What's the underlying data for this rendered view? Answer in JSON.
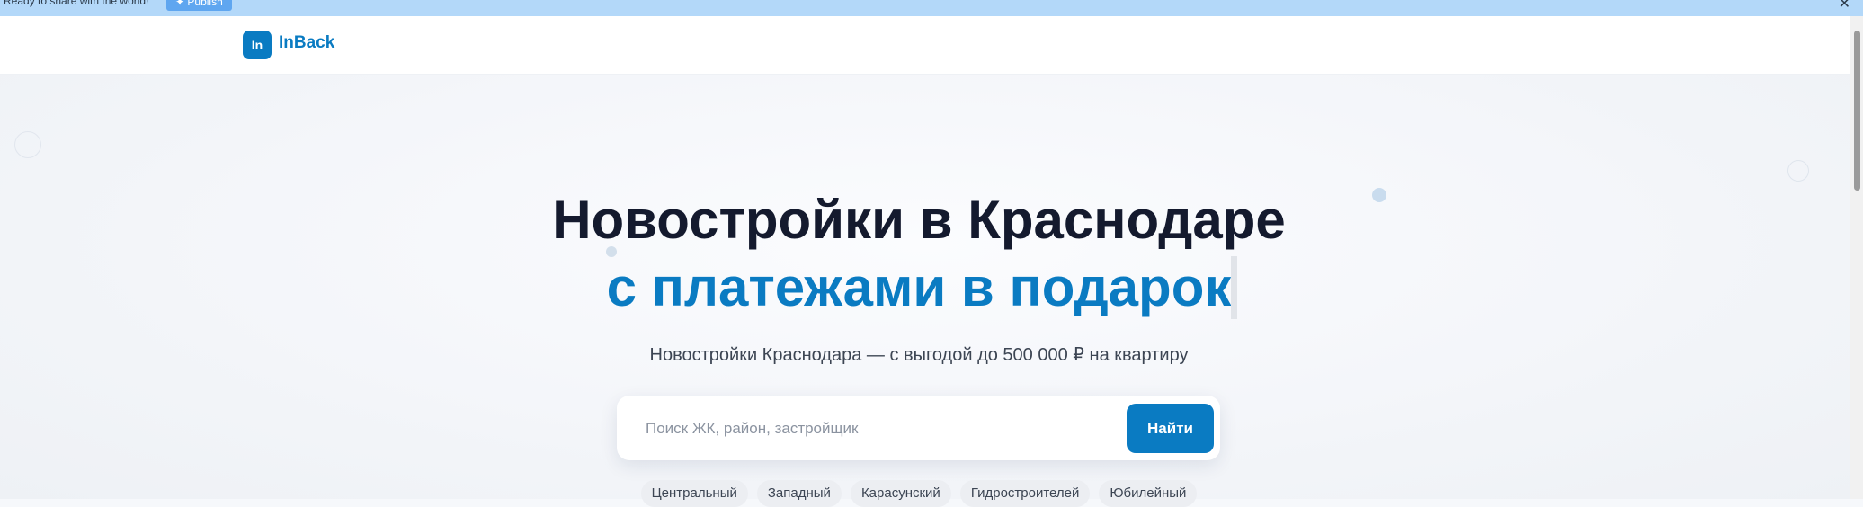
{
  "topbar": {
    "message": "Ready to share with the world!",
    "publish_label": "✦ Publish",
    "close_glyph": "✕",
    "color": "#b3d8f9"
  },
  "header": {
    "logo_badge": "In",
    "logo_text": "InBack",
    "brand_color": "#0a7bc2"
  },
  "hero": {
    "title_line1": "Новостройки в Краснодаре",
    "title_line2": "с платежами в подарок",
    "subtitle": "Новостройки Краснодара — с выгодой до 500 000 ₽ на квартиру"
  },
  "search": {
    "placeholder": "Поиск ЖК, район, застройщик",
    "button_label": "Найти"
  },
  "districts": [
    "Центральный",
    "Западный",
    "Карасунский",
    "Гидростроителей",
    "Юбилейный"
  ],
  "icons": {
    "close": "close-icon",
    "publish": "sparkle-icon"
  }
}
